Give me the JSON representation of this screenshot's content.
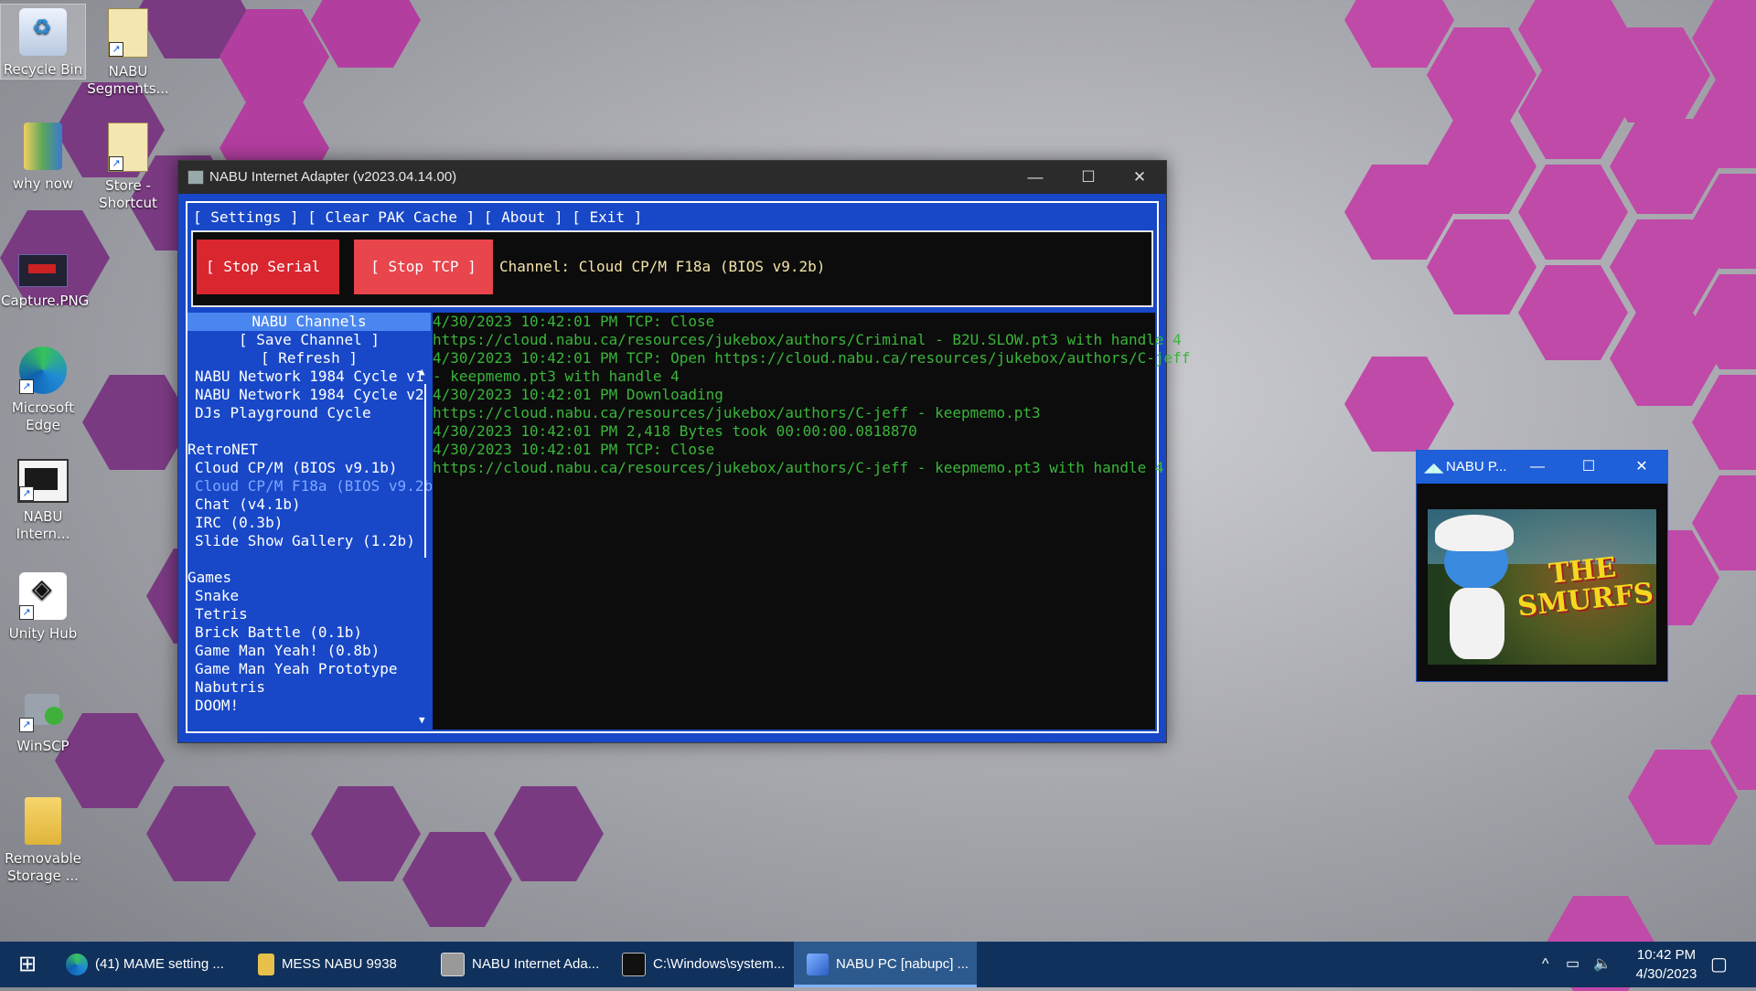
{
  "desktop": {
    "icons": [
      {
        "label": "Recycle Bin"
      },
      {
        "label": "NABU Segments..."
      },
      {
        "label": "why now"
      },
      {
        "label": "Store - Shortcut"
      },
      {
        "label": "Capture.PNG"
      },
      {
        "label": "Microsoft Edge"
      },
      {
        "label": "NABU Intern..."
      },
      {
        "label": "Unity Hub"
      },
      {
        "label": "WinSCP"
      },
      {
        "label": "Removable Storage ..."
      }
    ]
  },
  "main_window": {
    "title": "NABU Internet Adapter (v2023.04.14.00)",
    "controls": {
      "minimize": "—",
      "maximize": "☐",
      "close": "✕"
    },
    "menu": {
      "settings": "[ Settings ]",
      "clear_cache": "[ Clear PAK Cache ]",
      "about": "[ About ]",
      "exit": "[ Exit ]"
    },
    "stop_serial": "[ Stop Serial ]",
    "stop_tcp": "[ Stop TCP ]",
    "channel": "Channel: Cloud CP/M F18a (BIOS v9.2b)",
    "colors": {
      "accent": "#1848c8",
      "serial_btn": "#d9262f",
      "tcp_btn": "#e8454d",
      "log_text": "#3ab53a"
    },
    "sidebar": {
      "header": "NABU Channels",
      "save": "[ Save Channel ]",
      "refresh": "[ Refresh ]",
      "nabu_items": [
        "NABU Network 1984 Cycle v1",
        "NABU Network 1984 Cycle v2",
        "DJs Playground Cycle"
      ],
      "retronet_title": "RetroNET",
      "retronet_items": [
        "Cloud CP/M (BIOS v9.1b)",
        "Cloud CP/M F18a (BIOS v9.2b)",
        "Chat (v4.1b)",
        "IRC (0.3b)",
        "Slide Show Gallery (1.2b)"
      ],
      "games_title": "Games",
      "games_items": [
        "Snake",
        "Tetris",
        "Brick Battle (0.1b)",
        "Game Man Yeah! (0.8b)",
        "Game Man Yeah Prototype",
        "Nabutris",
        "DOOM!"
      ]
    },
    "log": [
      "4/30/2023 10:42:01 PM TCP: Close",
      "https://cloud.nabu.ca/resources/jukebox/authors/Criminal - B2U.SLOW.pt3 with handle 4",
      "4/30/2023 10:42:01 PM TCP: Open https://cloud.nabu.ca/resources/jukebox/authors/C-jeff",
      "- keepmemo.pt3 with handle 4",
      "4/30/2023 10:42:01 PM Downloading",
      "https://cloud.nabu.ca/resources/jukebox/authors/C-jeff - keepmemo.pt3",
      "4/30/2023 10:42:01 PM 2,418 Bytes took 00:00:00.0818870",
      "4/30/2023 10:42:01 PM TCP: Close",
      "https://cloud.nabu.ca/resources/jukebox/authors/C-jeff - keepmemo.pt3 with handle 4"
    ]
  },
  "small_window": {
    "title": "NABU P...",
    "game_title": "THE SMURFS",
    "controls": {
      "minimize": "—",
      "maximize": "☐",
      "close": "✕"
    }
  },
  "taskbar": {
    "start": "⊞",
    "items": [
      {
        "label": "(41) MAME setting ..."
      },
      {
        "label": "MESS NABU 9938"
      },
      {
        "label": "NABU Internet Ada..."
      },
      {
        "label": "C:\\Windows\\system..."
      },
      {
        "label": "NABU PC [nabupc] ..."
      }
    ],
    "time": "10:42 PM",
    "date": "4/30/2023"
  }
}
